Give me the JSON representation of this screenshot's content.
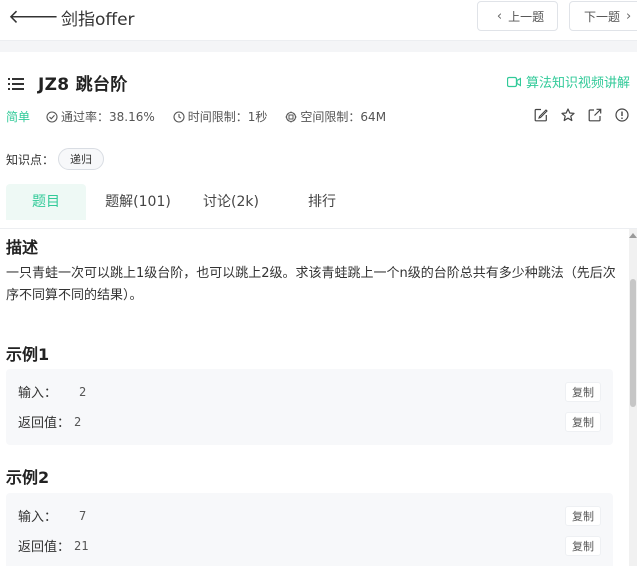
{
  "header": {
    "back_label": "剑指offer",
    "prev_label": "上一题",
    "next_label": "下一题"
  },
  "question": {
    "title": "JZ8  跳台阶",
    "video_link": "算法知识视频讲解",
    "difficulty": "简单",
    "pass_rate": "通过率：38.16%",
    "time_limit": "时间限制：1秒",
    "space_limit": "空间限制：64M",
    "knowledge_label": "知识点：",
    "knowledge_tag": "递归"
  },
  "tabs": [
    {
      "label": "题目"
    },
    {
      "label": "题解(101)"
    },
    {
      "label": "讨论(2k)"
    },
    {
      "label": "排行"
    }
  ],
  "content": {
    "desc_heading": "描述",
    "description": "一只青蛙一次可以跳上1级台阶，也可以跳上2级。求该青蛙跳上一个n级的台阶总共有多少种跳法（先后次序不同算不同的结果）。",
    "examples": [
      {
        "heading": "示例1",
        "input_label": "输入：",
        "input_value": "2",
        "output_label": "返回值：",
        "output_value": "2",
        "copy_label": "复制"
      },
      {
        "heading": "示例2",
        "input_label": "输入：",
        "input_value": "7",
        "output_label": "返回值：",
        "output_value": "21",
        "copy_label": "复制"
      }
    ]
  },
  "colors": {
    "accent": "#32ca99",
    "text": "#333333",
    "muted": "#555555",
    "background": "#f4f5f7"
  },
  "icons": [
    "arrow-left-icon",
    "chevron-left-icon",
    "chevron-right-icon",
    "list-icon",
    "video-icon",
    "check-circle-icon",
    "clock-icon",
    "chip-icon",
    "edit-icon",
    "star-icon",
    "share-icon",
    "info-icon"
  ]
}
